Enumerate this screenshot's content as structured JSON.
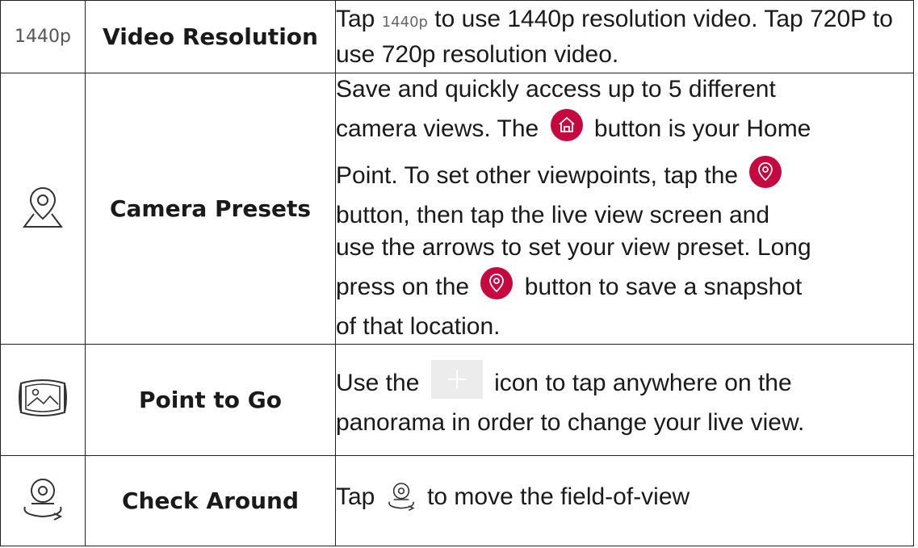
{
  "rows": [
    {
      "icon_label": "1440p",
      "name": "Video Resolution",
      "desc": {
        "p1": "Tap",
        "inline_label": "1440p",
        "p2": "to use 1440p resolution video. Tap 720P to use 720p resolution video."
      }
    },
    {
      "icon": "map-pin-icon",
      "name": "Camera Presets",
      "desc": {
        "l1": "Save and quickly access up to 5 different",
        "l2a": "camera views. The",
        "l2b": "button is your Home",
        "l3": "Point. To set other viewpoints, tap the",
        "l4": "button, then tap the live view screen and",
        "l5": "use the arrows to set your view preset. Long",
        "l6a": "press on the",
        "l6b": "button to save a snapshot",
        "l7": "of that location."
      }
    },
    {
      "icon": "panorama-icon",
      "name": "Point to Go",
      "desc": {
        "l1a": "Use the",
        "l1b": "icon to tap anywhere on the",
        "l2": "panorama in order to change your live view."
      }
    },
    {
      "icon": "check-around-icon",
      "name": "Check Around",
      "desc": {
        "p1": "Tap",
        "p2": "to move the field-of-view"
      }
    }
  ],
  "colors": {
    "accent_button": "#c5083f",
    "border": "#222222",
    "plus_box": "#ececec"
  }
}
